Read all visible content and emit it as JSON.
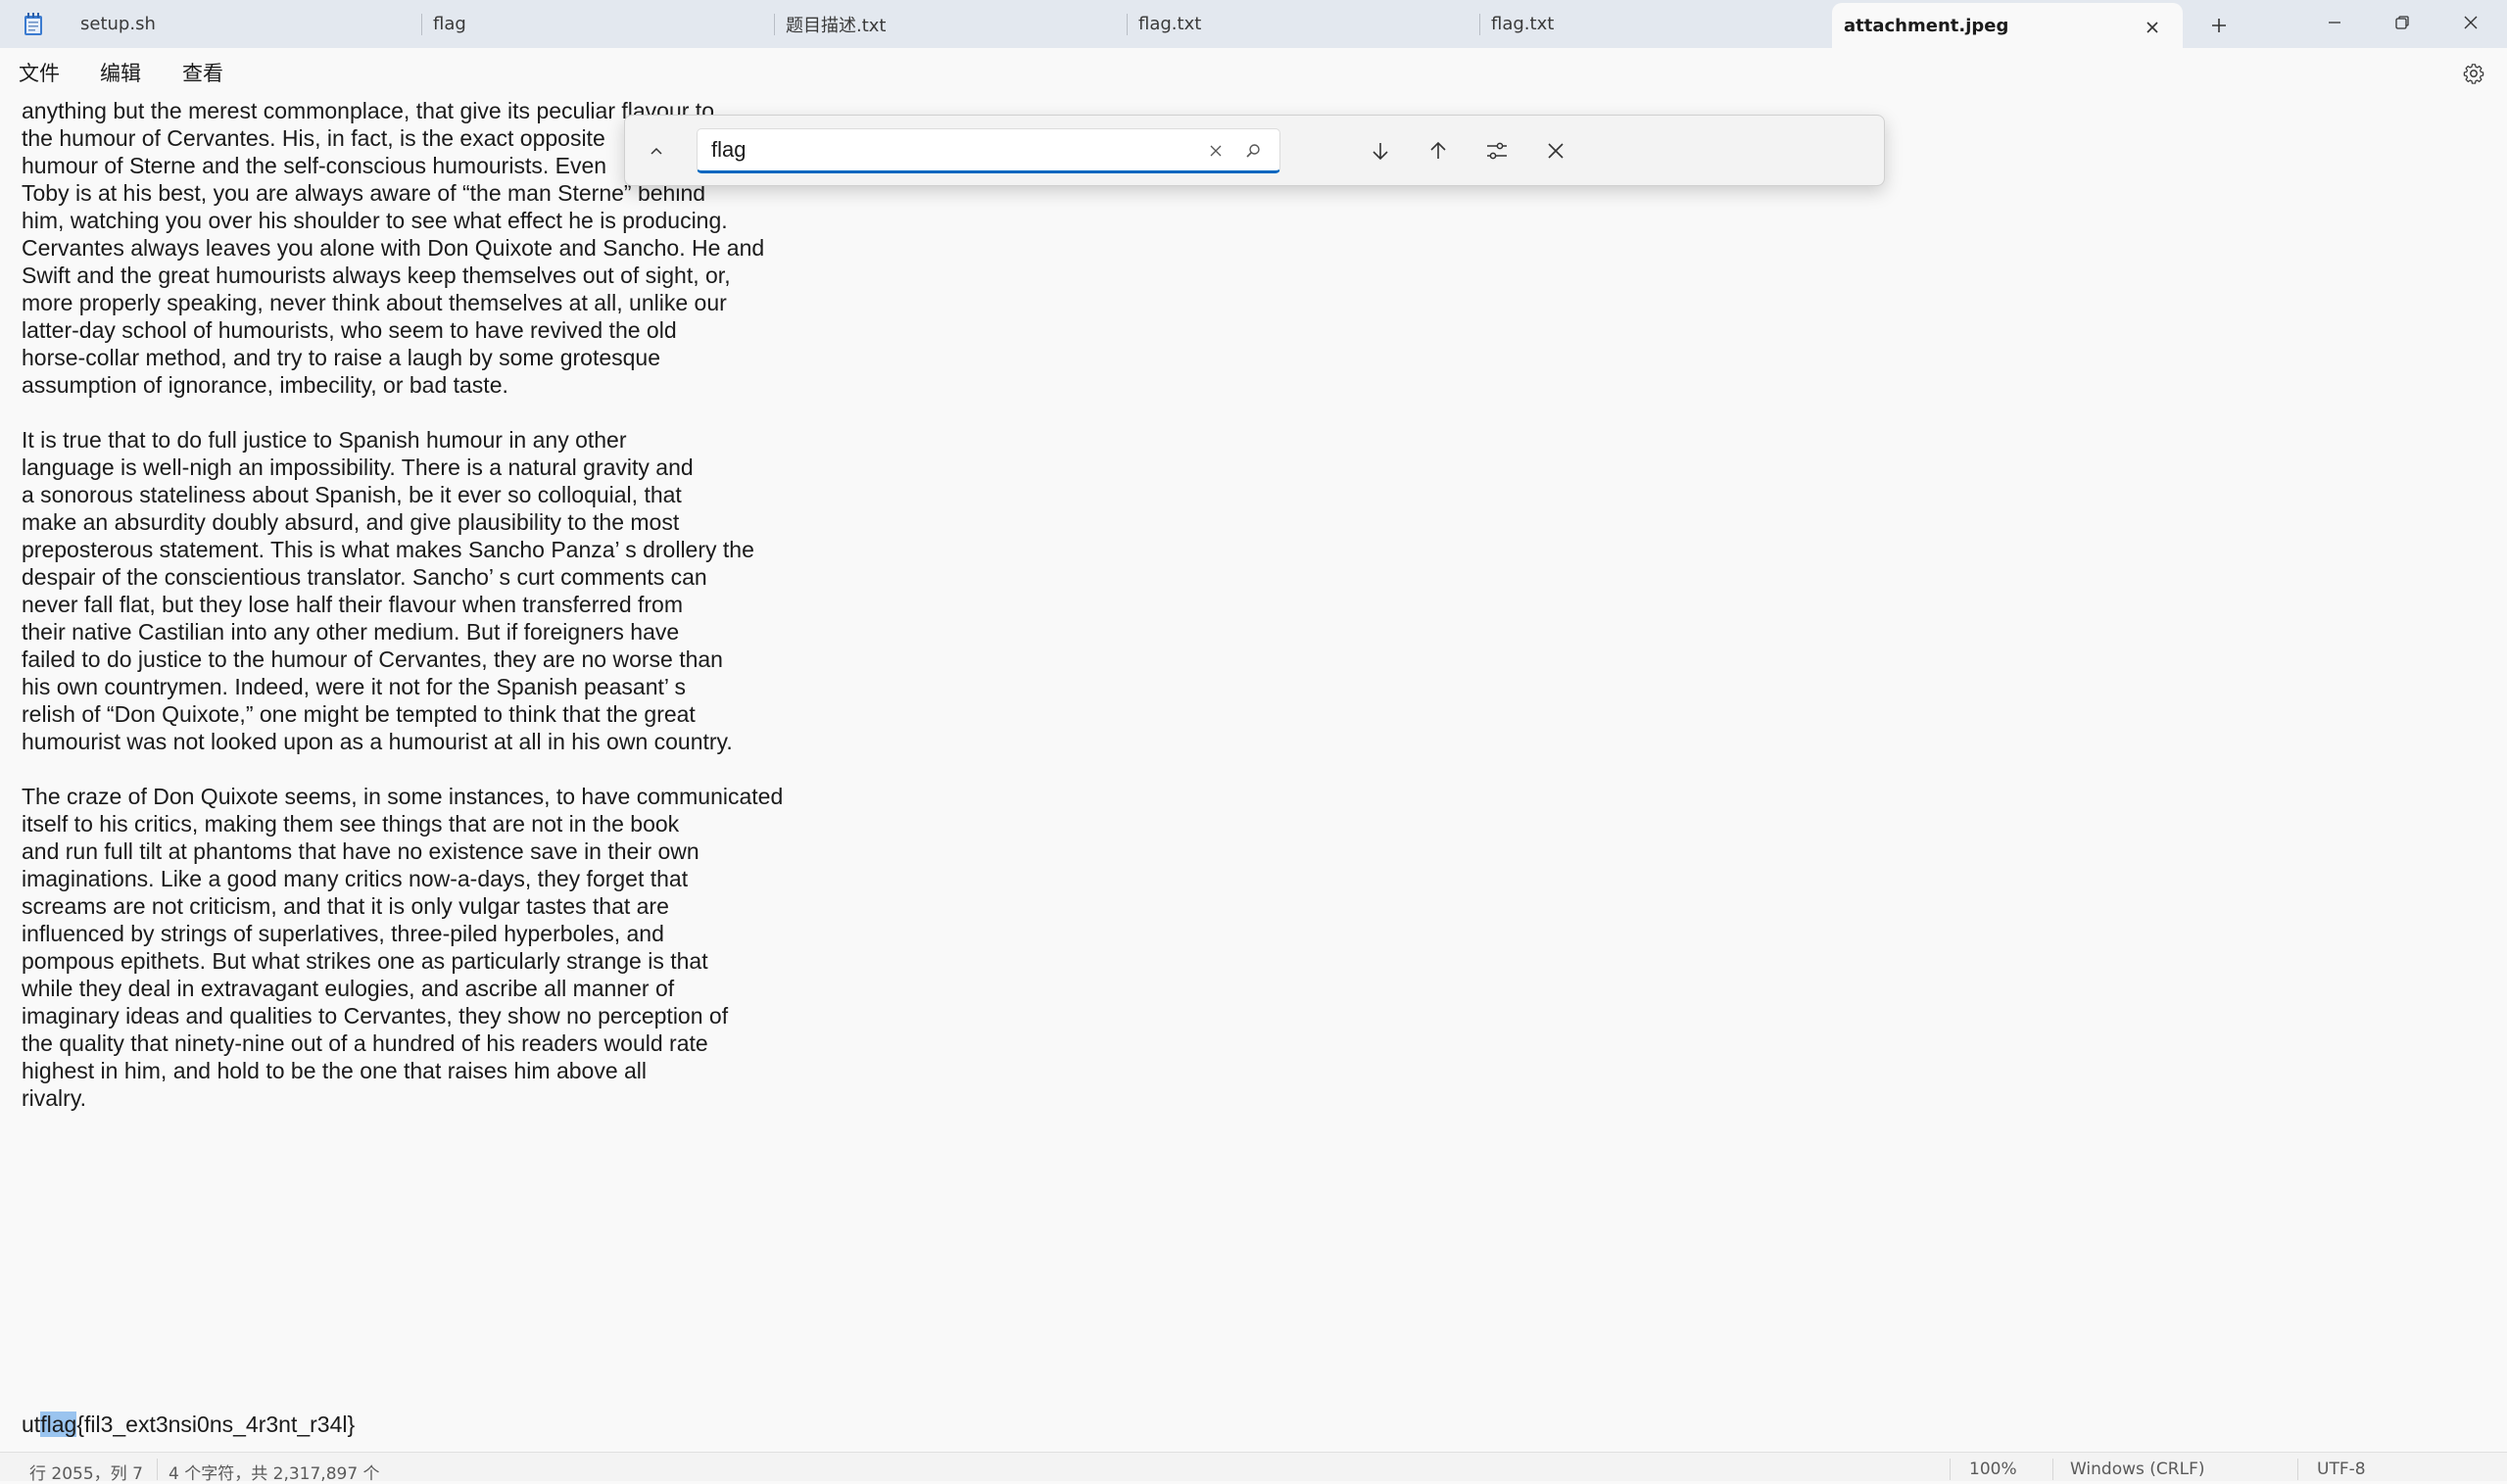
{
  "tabs": [
    {
      "label": "setup.sh"
    },
    {
      "label": "flag"
    },
    {
      "label": "题目描述.txt"
    },
    {
      "label": "flag.txt"
    },
    {
      "label": "flag.txt"
    },
    {
      "label": "attachment.jpeg"
    }
  ],
  "menu": {
    "file": "文件",
    "edit": "编辑",
    "view": "查看"
  },
  "find": {
    "value": "flag"
  },
  "document": {
    "lines": [
      "anything but the merest commonplace, that give its peculiar flavour to",
      "the humour of Cervantes. His, in fact, is the exact opposite",
      "humour of Sterne and the self-conscious humourists. Even",
      "Toby is at his best, you are always aware of “the man Sterne” behind",
      "him, watching you over his shoulder to see what effect he is producing.",
      "Cervantes always leaves you alone with Don Quixote and Sancho. He and",
      "Swift and the great humourists always keep themselves out of sight, or,",
      "more properly speaking, never think about themselves at all, unlike our",
      "latter-day school of humourists, who seem to have revived the old",
      "horse-collar method, and try to raise a laugh by some grotesque",
      "assumption of ignorance, imbecility, or bad taste.",
      "",
      "It is true that to do full justice to Spanish humour in any other",
      "language is well-nigh an impossibility. There is a natural gravity and",
      "a sonorous stateliness about Spanish, be it ever so colloquial, that",
      "make an absurdity doubly absurd, and give plausibility to the most",
      "preposterous statement. This is what makes Sancho Panza’ s drollery the",
      "despair of the conscientious translator. Sancho’ s curt comments can",
      "never fall flat, but they lose half their flavour when transferred from",
      "their native Castilian into any other medium. But if foreigners have",
      "failed to do justice to the humour of Cervantes, they are no worse than",
      "his own countrymen. Indeed, were it not for the Spanish peasant’ s",
      "relish of “Don Quixote,” one might be tempted to think that the great",
      "humourist was not looked upon as a humourist at all in his own country.",
      "",
      "The craze of Don Quixote seems, in some instances, to have communicated",
      "itself to his critics, making them see things that are not in the book",
      "and run full tilt at phantoms that have no existence save in their own",
      "imaginations. Like a good many critics now-a-days, they forget that",
      "screams are not criticism, and that it is only vulgar tastes that are",
      "influenced by strings of superlatives, three-piled hyperboles, and",
      "pompous epithets. But what strikes one as particularly strange is that",
      "while they deal in extravagant eulogies, and ascribe all manner of",
      "imaginary ideas and qualities to Cervantes, they show no perception of",
      "the quality that ninety-nine out of a hundred of his readers would rate",
      "highest in him, and hold to be the one that raises him above all",
      "rivalry."
    ],
    "flag_line": {
      "before": "ut",
      "match": "flag",
      "after": "{fil3_ext3nsi0ns_4r3nt_r34l}"
    }
  },
  "status": {
    "position": "行 2055，列 7",
    "selection": "4 个字符，共 2,317,897 个",
    "zoom": "100%",
    "line_ending": "Windows (CRLF)",
    "encoding": "UTF-8"
  },
  "colors": {
    "accent": "#0067c0",
    "match_highlight": "#9ac4ef",
    "tabbar_bg": "#e3e8ef"
  }
}
